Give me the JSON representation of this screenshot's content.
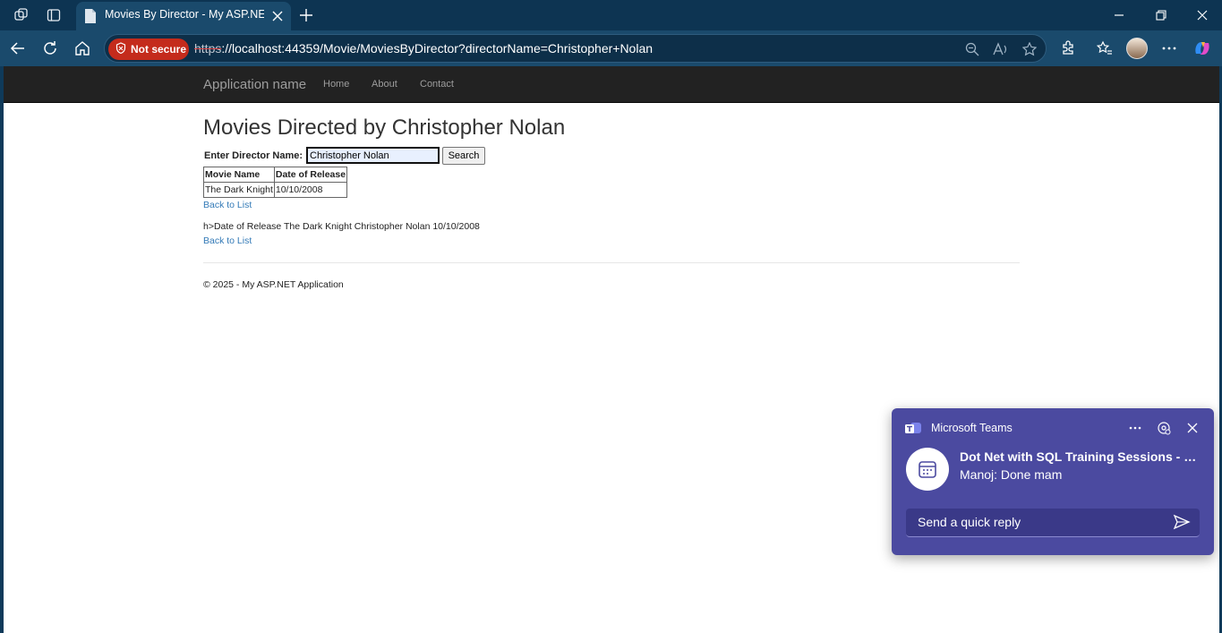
{
  "browser": {
    "tab_title": "Movies By Director - My ASP.NET",
    "security_label": "Not secure",
    "url_scheme": "https",
    "url_rest": "://localhost:44359/Movie/MoviesByDirector?directorName=Christopher+Nolan",
    "new_tab_symbol": "+"
  },
  "site": {
    "brand": "Application name",
    "nav": [
      "Home",
      "About",
      "Contact"
    ]
  },
  "page": {
    "heading": "Movies Directed by Christopher Nolan",
    "form": {
      "label": "Enter Director Name:",
      "input_value": "Christopher Nolan",
      "button_label": "Search"
    },
    "table": {
      "headers": [
        "Movie Name",
        "Date of Release"
      ],
      "rows": [
        [
          "The Dark Knight",
          "10/10/2008"
        ]
      ]
    },
    "back_link_1": "Back to List",
    "raw_text": "h>Date of Release The Dark Knight Christopher Nolan 10/10/2008",
    "back_link_2": "Back to List",
    "footer": "© 2025 - My ASP.NET Application"
  },
  "toast": {
    "app_name": "Microsoft Teams",
    "title": "Dot Net with SQL Training Sessions - Q...",
    "body": "Manoj: Done mam",
    "reply_placeholder": "Send a quick reply"
  },
  "colors": {
    "teams_bg": "#4b4aa0",
    "navbar_bg": "#222222",
    "link": "#337ab7",
    "not_secure": "#c42b1c"
  }
}
